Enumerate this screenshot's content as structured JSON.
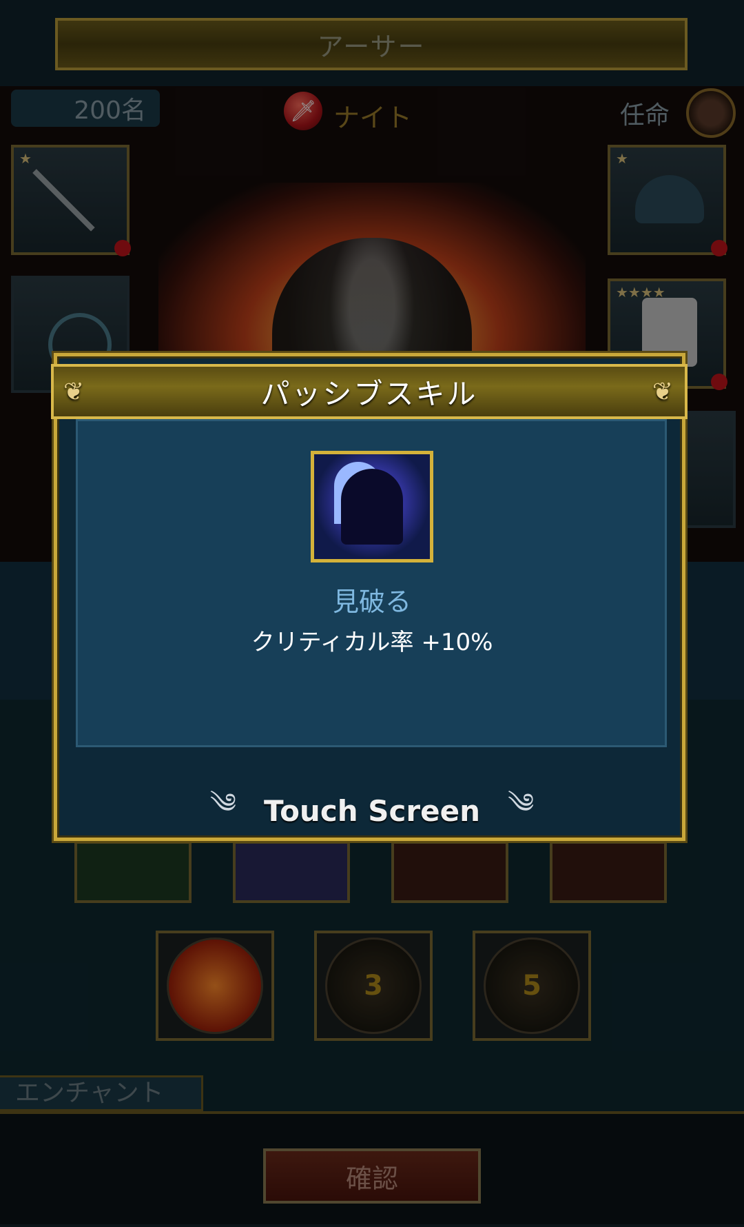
{
  "header": {
    "character_name": "アーサー"
  },
  "info": {
    "count": "200名",
    "class_name": "ナイト",
    "appoint_label": "任命"
  },
  "lower": {
    "skill_levels": [
      "3",
      "5"
    ],
    "enchant_tab": "エンチャント",
    "confirm_button": "確認"
  },
  "dialog": {
    "title": "パッシブスキル",
    "skill_name": "見破る",
    "skill_effect": "クリティカル率 +10%",
    "touch_hint": "Touch Screen"
  },
  "colors": {
    "gold_frame": "#c9a83a",
    "dialog_bg": "#0d2838",
    "panel_bg": "#173f58",
    "skill_name": "#7fb8e0"
  }
}
